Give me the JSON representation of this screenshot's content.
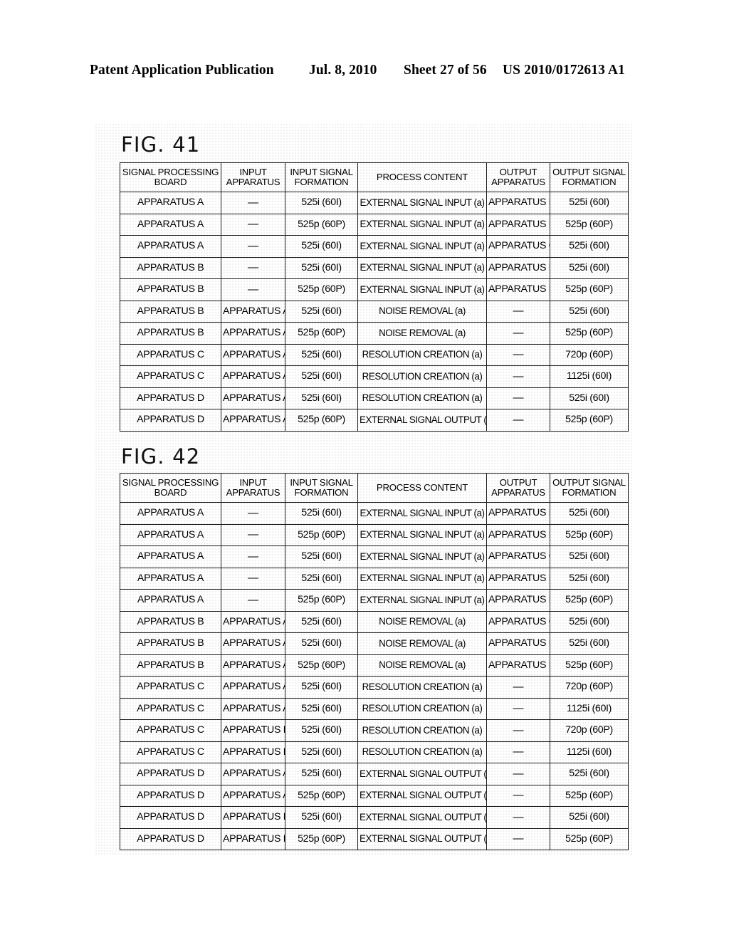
{
  "page_header": {
    "publication": "Patent Application Publication",
    "date": "Jul. 8, 2010",
    "sheet": "Sheet 27 of 56",
    "publication_number": "US 2010/0172613 A1"
  },
  "columns": {
    "board_line1": "SIGNAL PROCESSING",
    "board_line2": "BOARD",
    "input_apparatus_line1": "INPUT",
    "input_apparatus_line2": "APPARATUS",
    "input_signal_line1": "INPUT SIGNAL",
    "input_signal_line2": "FORMATION",
    "process_content": "PROCESS CONTENT",
    "output_apparatus_line1": "OUTPUT",
    "output_apparatus_line2": "APPARATUS",
    "output_signal_line1": "OUTPUT SIGNAL",
    "output_signal_line2": "FORMATION"
  },
  "figures": [
    {
      "id": "fig41",
      "title": "FIG. 41",
      "rows": [
        [
          "APPARATUS A",
          "—",
          "525i (60I)",
          "EXTERNAL SIGNAL INPUT (a)",
          "APPARATUS B",
          "525i (60I)"
        ],
        [
          "APPARATUS A",
          "—",
          "525p (60P)",
          "EXTERNAL SIGNAL INPUT (a)",
          "APPARATUS B",
          "525p (60P)"
        ],
        [
          "APPARATUS A",
          "—",
          "525i (60I)",
          "EXTERNAL SIGNAL INPUT (a)",
          "APPARATUS C",
          "525i (60I)"
        ],
        [
          "APPARATUS B",
          "—",
          "525i (60I)",
          "EXTERNAL SIGNAL INPUT (a)",
          "APPARATUS D",
          "525i (60I)"
        ],
        [
          "APPARATUS B",
          "—",
          "525p (60P)",
          "EXTERNAL SIGNAL INPUT (a)",
          "APPARATUS D",
          "525p (60P)"
        ],
        [
          "APPARATUS B",
          "APPARATUS A",
          "525i (60I)",
          "NOISE REMOVAL (a)",
          "—",
          "525i (60I)"
        ],
        [
          "APPARATUS B",
          "APPARATUS A",
          "525p (60P)",
          "NOISE REMOVAL (a)",
          "—",
          "525p (60P)"
        ],
        [
          "APPARATUS C",
          "APPARATUS A",
          "525i (60I)",
          "RESOLUTION CREATION (a)",
          "—",
          "720p (60P)"
        ],
        [
          "APPARATUS C",
          "APPARATUS A",
          "525i (60I)",
          "RESOLUTION CREATION (a)",
          "—",
          "1125i (60I)"
        ],
        [
          "APPARATUS D",
          "APPARATUS A",
          "525i (60I)",
          "RESOLUTION CREATION (a)",
          "—",
          "525i (60I)"
        ],
        [
          "APPARATUS D",
          "APPARATUS A",
          "525p (60P)",
          "EXTERNAL SIGNAL OUTPUT (a)",
          "—",
          "525p (60P)"
        ]
      ]
    },
    {
      "id": "fig42",
      "title": "FIG. 42",
      "rows": [
        [
          "APPARATUS A",
          "—",
          "525i (60I)",
          "EXTERNAL SIGNAL INPUT (a)",
          "APPARATUS B",
          "525i (60I)"
        ],
        [
          "APPARATUS A",
          "—",
          "525p (60P)",
          "EXTERNAL SIGNAL INPUT (a)",
          "APPARATUS B",
          "525p (60P)"
        ],
        [
          "APPARATUS A",
          "—",
          "525i (60I)",
          "EXTERNAL SIGNAL INPUT (a)",
          "APPARATUS C",
          "525i (60I)"
        ],
        [
          "APPARATUS A",
          "—",
          "525i (60I)",
          "EXTERNAL SIGNAL INPUT (a)",
          "APPARATUS D",
          "525i (60I)"
        ],
        [
          "APPARATUS A",
          "—",
          "525p (60P)",
          "EXTERNAL SIGNAL INPUT (a)",
          "APPARATUS D",
          "525p (60P)"
        ],
        [
          "APPARATUS B",
          "APPARATUS A",
          "525i (60I)",
          "NOISE REMOVAL (a)",
          "APPARATUS C",
          "525i (60I)"
        ],
        [
          "APPARATUS B",
          "APPARATUS A",
          "525i (60I)",
          "NOISE REMOVAL (a)",
          "APPARATUS D",
          "525i (60I)"
        ],
        [
          "APPARATUS B",
          "APPARATUS A",
          "525p (60P)",
          "NOISE REMOVAL (a)",
          "APPARATUS D",
          "525p (60P)"
        ],
        [
          "APPARATUS C",
          "APPARATUS A",
          "525i (60I)",
          "RESOLUTION CREATION (a)",
          "—",
          "720p (60P)"
        ],
        [
          "APPARATUS C",
          "APPARATUS A",
          "525i (60I)",
          "RESOLUTION CREATION (a)",
          "—",
          "1125i (60I)"
        ],
        [
          "APPARATUS C",
          "APPARATUS B",
          "525i (60I)",
          "RESOLUTION CREATION (a)",
          "—",
          "720p (60P)"
        ],
        [
          "APPARATUS C",
          "APPARATUS B",
          "525i (60I)",
          "RESOLUTION CREATION (a)",
          "—",
          "1125i (60I)"
        ],
        [
          "APPARATUS D",
          "APPARATUS A",
          "525i (60I)",
          "EXTERNAL SIGNAL OUTPUT (a)",
          "—",
          "525i (60I)"
        ],
        [
          "APPARATUS D",
          "APPARATUS A",
          "525p (60P)",
          "EXTERNAL SIGNAL OUTPUT (a)",
          "—",
          "525p (60P)"
        ],
        [
          "APPARATUS D",
          "APPARATUS B",
          "525i (60I)",
          "EXTERNAL SIGNAL OUTPUT (a)",
          "—",
          "525i (60I)"
        ],
        [
          "APPARATUS D",
          "APPARATUS B",
          "525p (60P)",
          "EXTERNAL SIGNAL OUTPUT (a)",
          "—",
          "525p (60P)"
        ]
      ]
    }
  ]
}
